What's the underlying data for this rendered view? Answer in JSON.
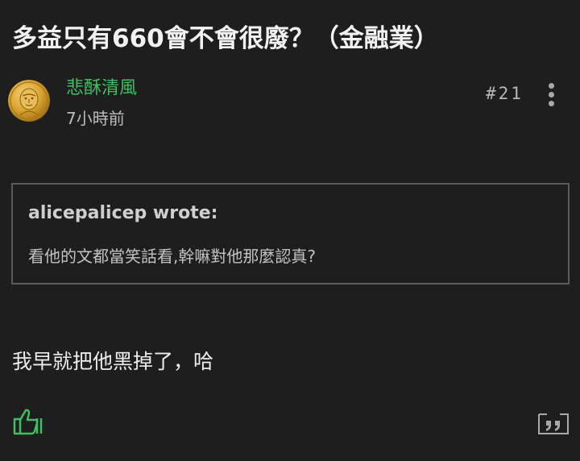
{
  "post": {
    "title": "多益只有660會不會很廢？（金融業）",
    "author": "悲酥清風",
    "time": "7小時前",
    "floor": "#21",
    "quote": {
      "author_line": "alicepalicep wrote:",
      "text": "看他的文都當笑話看,幹嘛對他那麼認真?"
    },
    "body": "我早就把他黑掉了，哈"
  },
  "icons": {
    "avatar": "coin-portrait-avatar",
    "more": "more-vertical-icon",
    "like": "thumbs-up-icon",
    "quote": "quote-reply-icon"
  },
  "colors": {
    "background": "#1e1e1e",
    "author": "#3fbf62",
    "like_icon": "#3fbf62",
    "quote_border": "#5a5a5a",
    "avatar_gold": "#d9a431"
  }
}
